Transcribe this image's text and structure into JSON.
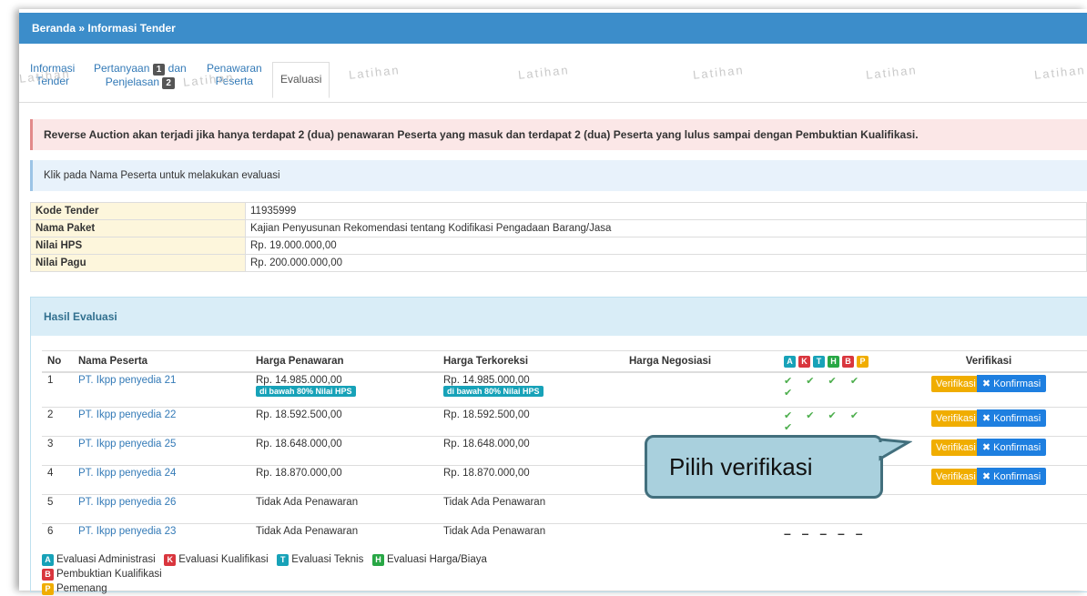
{
  "breadcrumb": "Beranda » Informasi Tender",
  "tabs": {
    "t1_l1": "Informasi",
    "t1_l2": "Tender",
    "t2_l1": "Pertanyaan",
    "t2_b1": "1",
    "t2_l2": "dan",
    "t2_l3": "Penjelasan",
    "t2_b2": "2",
    "t3_l1": "Penawaran",
    "t3_l2": "Peserta",
    "t4": "Evaluasi"
  },
  "watermark": "Latihan",
  "alerts": {
    "red": "Reverse Auction akan terjadi jika hanya terdapat 2 (dua) penawaran Peserta yang masuk dan terdapat 2 (dua) Peserta yang lulus sampai dengan Pembuktian Kualifikasi.",
    "blue": "Klik pada Nama Peserta untuk melakukan evaluasi"
  },
  "info": {
    "kode_label": "Kode Tender",
    "kode_value": "11935999",
    "paket_label": "Nama Paket",
    "paket_value": "Kajian Penyusunan Rekomendasi tentang Kodifikasi Pengadaan Barang/Jasa",
    "hps_label": "Nilai HPS",
    "hps_value": "Rp. 19.000.000,00",
    "pagu_label": "Nilai Pagu",
    "pagu_value": "Rp. 200.000.000,00"
  },
  "panel_title": "Hasil Evaluasi",
  "headers": {
    "no": "No",
    "nama": "Nama Peserta",
    "penawaran": "Harga Penawaran",
    "terkoreksi": "Harga Terkoreksi",
    "negosiasi": "Harga Negosiasi",
    "verifikasi": "Verifikasi"
  },
  "stage_codes": {
    "a": "A",
    "k": "K",
    "t": "T",
    "h": "H",
    "b": "B",
    "p": "P"
  },
  "colors": {
    "a": "#17a2b8",
    "k": "#d9363e",
    "t": "#17a2b8",
    "h": "#28a745",
    "b": "#d9363e",
    "p": "#f0ad00"
  },
  "rows": [
    {
      "no": "1",
      "nama": "PT. Ikpp penyedia 21",
      "penawaran": "Rp. 14.985.000,00",
      "terkoreksi": "Rp. 14.985.000,00",
      "note": "di bawah 80% Nilai HPS",
      "checks": "✔ ✔ ✔ ✔ ✔"
    },
    {
      "no": "2",
      "nama": "PT. Ikpp penyedia 22",
      "penawaran": "Rp. 18.592.500,00",
      "terkoreksi": "Rp. 18.592.500,00",
      "checks": "✔ ✔ ✔ ✔ ✔"
    },
    {
      "no": "3",
      "nama": "PT. Ikpp penyedia 25",
      "penawaran": "Rp. 18.648.000,00",
      "terkoreksi": "Rp. 18.648.000,00"
    },
    {
      "no": "4",
      "nama": "PT. Ikpp penyedia 24",
      "penawaran": "Rp. 18.870.000,00",
      "terkoreksi": "Rp. 18.870.000,00"
    },
    {
      "no": "5",
      "nama": "PT. Ikpp penyedia 26",
      "penawaran": "Tidak Ada Penawaran",
      "terkoreksi": "Tidak Ada Penawaran"
    },
    {
      "no": "6",
      "nama": "PT. Ikpp penyedia 23",
      "penawaran": "Tidak Ada Penawaran",
      "terkoreksi": "Tidak Ada Penawaran",
      "dashes": "– – – – –"
    }
  ],
  "buttons": {
    "verifikasi": "Verifikasi",
    "konfirmasi": "Konfirmasi"
  },
  "legend": {
    "a": "Evaluasi Administrasi",
    "k": "Evaluasi Kualifikasi",
    "t": "Evaluasi Teknis",
    "h": "Evaluasi Harga/Biaya",
    "b": "Pembuktian Kualifikasi",
    "p": "Pemenang"
  },
  "callout": "Pilih verifikasi"
}
